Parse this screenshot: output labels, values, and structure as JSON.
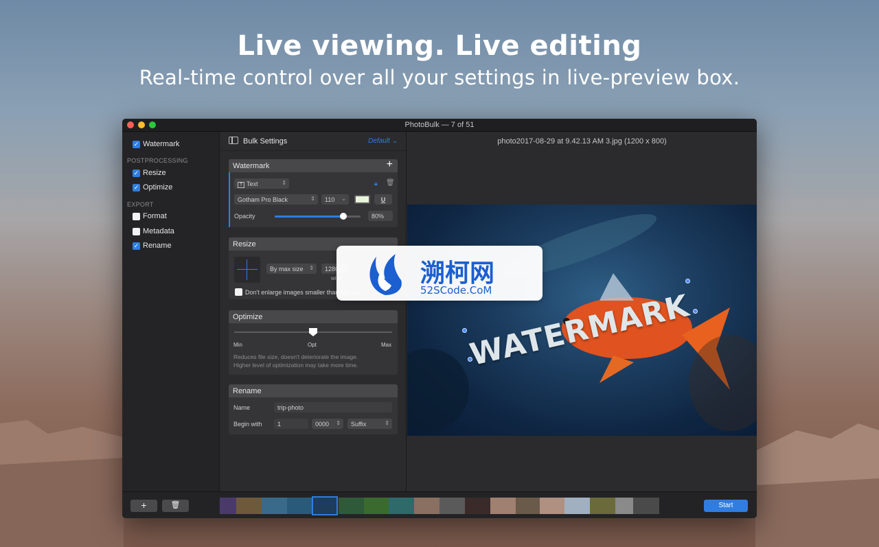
{
  "hero": {
    "title": "Live viewing. Live editing",
    "subtitle": "Real-time control over all your settings in live-preview box."
  },
  "window": {
    "title": "PhotoBulk — 7 of 51"
  },
  "sidebar": {
    "items": [
      {
        "label": "Watermark",
        "checked": true
      },
      {
        "section": "POSTPROCESSING"
      },
      {
        "label": "Resize",
        "checked": true
      },
      {
        "label": "Optimize",
        "checked": true
      },
      {
        "section": "EXPORT"
      },
      {
        "label": "Format",
        "checked": false
      },
      {
        "label": "Metadata",
        "checked": false
      },
      {
        "label": "Rename",
        "checked": true
      }
    ],
    "watermark": "Watermark",
    "postprocessing": "POSTPROCESSING",
    "resize": "Resize",
    "optimize": "Optimize",
    "export": "EXPORT",
    "format": "Format",
    "metadata": "Metadata",
    "rename": "Rename"
  },
  "settings": {
    "header": "Bulk Settings",
    "preset": "Default",
    "watermark_panel": {
      "title": "Watermark",
      "type": "Text",
      "font": "Gotham Pro Black",
      "size": "110",
      "opacity_label": "Opacity",
      "opacity_value": "80%",
      "opacity_fraction": 0.8,
      "text_color": "#e8f5dc"
    },
    "resize_panel": {
      "title": "Resize",
      "mode": "By max size",
      "value": "1280 px",
      "unit": "wide",
      "checkbox_label": "Don't enlarge images smaller than set size"
    },
    "optimize_panel": {
      "title": "Optimize",
      "min": "Min",
      "opt": "Opt",
      "max": "Max",
      "level_fraction": 0.5,
      "hint_line1": "Reduces file size, doesn't deteriorate the image.",
      "hint_line2": "Higher level of optimization may take more time."
    },
    "rename_panel": {
      "title": "Rename",
      "name_label": "Name",
      "name_value": "trip-photo",
      "begin_label": "Begin with",
      "begin_value": "1",
      "digits": "0000",
      "position": "Suffix"
    }
  },
  "preview": {
    "caption": "photo2017-08-29 at 9.42.13 AM 3.jpg (1200 x 800)",
    "watermark_text": "WATERMARK"
  },
  "bottombar": {
    "add": "+",
    "start": "Start"
  },
  "overlay": {
    "cn": "溯柯网",
    "en": "52SCode.CoM"
  },
  "colors": {
    "accent": "#2f7de1"
  }
}
